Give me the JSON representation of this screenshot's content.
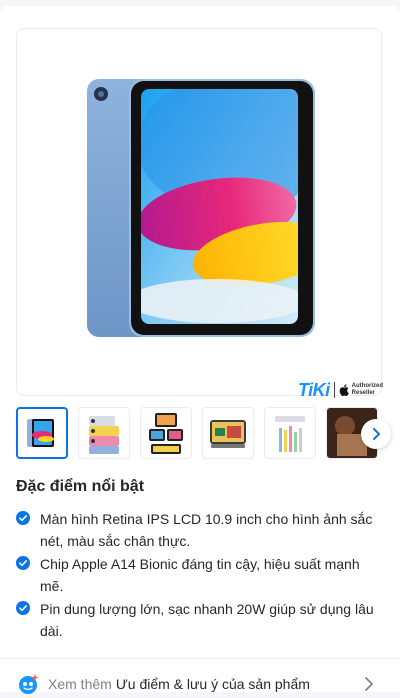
{
  "product": {
    "image_alt": "iPad Gen 10 Blue",
    "brand": {
      "logo_text": "TiKi",
      "apple_icon": "apple-logo-icon",
      "auth_line1": "Authorized",
      "auth_line2": "Reseller"
    }
  },
  "gallery": {
    "thumbnails": [
      {
        "name": "ipad-blue-front",
        "active": true
      },
      {
        "name": "ipad-colors",
        "active": false
      },
      {
        "name": "ipad-accessories",
        "active": false
      },
      {
        "name": "ipad-keyboard",
        "active": false
      },
      {
        "name": "ipad-pencil",
        "active": false
      },
      {
        "name": "ipad-lifestyle",
        "active": false
      }
    ],
    "next_icon": "chevron-right-icon"
  },
  "highlights": {
    "title": "Đặc điểm nổi bật",
    "items": [
      "Màn hình Retina IPS LCD 10.9 inch cho hình ảnh sắc nét, màu sắc chân thực.",
      "Chip Apple A14 Bionic đáng tin cậy, hiệu suất mạnh mẽ.",
      "Pin dung lượng lớn, sạc nhanh 20W giúp sử dụng lâu dài."
    ],
    "check_color": "#0b74e5"
  },
  "more": {
    "label_prefix": "Xem thêm",
    "label_main": "Ưu điểm & lưu ý của sản phẩm",
    "icon": "ai-assistant-icon",
    "chevron": "chevron-right-icon"
  },
  "colors": {
    "accent": "#0b74e5",
    "tiki_blue": "#1a94ff"
  }
}
